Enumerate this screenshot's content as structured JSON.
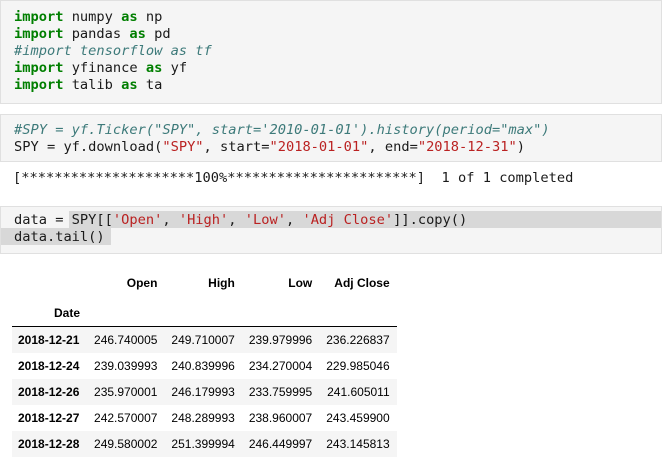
{
  "cell1": {
    "line1": {
      "kw1": "import",
      "text1": " numpy ",
      "kw2": "as",
      "text2": " np"
    },
    "line2": {
      "kw1": "import",
      "text1": " pandas ",
      "kw2": "as",
      "text2": " pd"
    },
    "line3": {
      "comment": "#import tensorflow as tf"
    },
    "line4": {
      "kw1": "import",
      "text1": " yfinance ",
      "kw2": "as",
      "text2": " yf"
    },
    "line5": {
      "kw1": "import",
      "text1": " talib ",
      "kw2": "as",
      "text2": " ta"
    }
  },
  "cell2": {
    "line1": {
      "comment": "#SPY = yf.Ticker(\"SPY\", start='2010-01-01').history(period=\"max\")"
    },
    "line2": {
      "t1": "SPY = yf.download(",
      "s1": "\"SPY\"",
      "t2": ", start=",
      "s2": "\"2018-01-01\"",
      "t3": ", end=",
      "s3": "\"2018-12-31\"",
      "t4": ")"
    }
  },
  "output": {
    "progress_text": "[*********************100%***********************]  1 of 1 completed"
  },
  "cell3": {
    "line1": {
      "t1": "data = SPY[[",
      "s1": "'Open'",
      "t2": ", ",
      "s2": "'High'",
      "t3": ", ",
      "s3": "'Low'",
      "t4": ", ",
      "s4": "'Adj Close'",
      "t5": "]].copy()"
    },
    "line2": {
      "t1": "data.tail()"
    }
  },
  "dataframe": {
    "columns": [
      "Open",
      "High",
      "Low",
      "Adj Close"
    ],
    "index_name": "Date",
    "rows": [
      {
        "date": "2018-12-21",
        "values": [
          "246.740005",
          "249.710007",
          "239.979996",
          "236.226837"
        ]
      },
      {
        "date": "2018-12-24",
        "values": [
          "239.039993",
          "240.839996",
          "234.270004",
          "229.985046"
        ]
      },
      {
        "date": "2018-12-26",
        "values": [
          "235.970001",
          "246.179993",
          "233.759995",
          "241.605011"
        ]
      },
      {
        "date": "2018-12-27",
        "values": [
          "242.570007",
          "248.289993",
          "238.960007",
          "243.459900"
        ]
      },
      {
        "date": "2018-12-28",
        "values": [
          "249.580002",
          "251.399994",
          "246.449997",
          "243.145813"
        ]
      }
    ]
  }
}
